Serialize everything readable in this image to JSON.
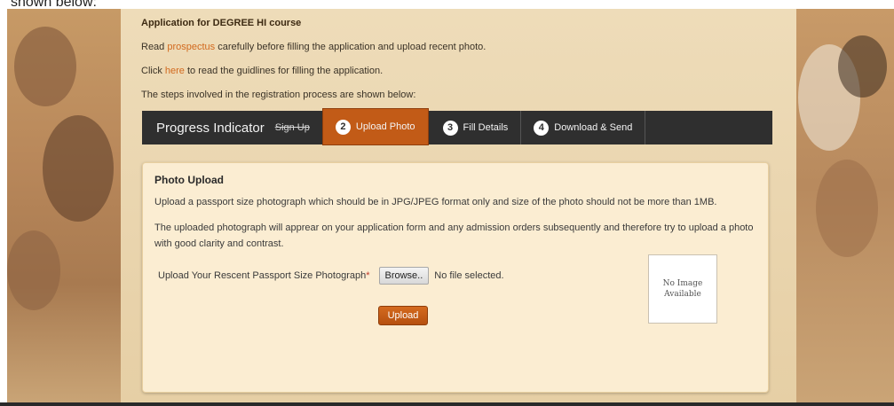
{
  "caption": "shown below:",
  "intro": {
    "title": "Application for DEGREE HI course",
    "line1_pre": "Read",
    "line1_link": "prospectus",
    "line1_post": "carefully before filling the application and upload recent photo.",
    "line2_pre": "Click",
    "line2_link": "here",
    "line2_post": "to read the guidlines for filling the application.",
    "line3": "The steps involved in the registration process are shown below:"
  },
  "progress": {
    "label": "Progress Indicator",
    "signup": "Sign Up",
    "steps": [
      {
        "num": "2",
        "label": "Upload Photo",
        "active": true
      },
      {
        "num": "3",
        "label": "Fill Details",
        "active": false
      },
      {
        "num": "4",
        "label": "Download & Send",
        "active": false
      }
    ]
  },
  "panel": {
    "heading": "Photo Upload",
    "text1": "Upload a passport size photograph which should be in JPG/JPEG format only and size of the photo should not be more than 1MB.",
    "text2": "The uploaded photograph will apprear on your application form and any admission orders subsequently and therefore try to upload a photo with good clarity and contrast.",
    "field_label": "Upload Your Rescent Passport Size Photograph",
    "required_mark": "*",
    "browse_label": "Browse..",
    "file_status": "No file selected.",
    "upload_label": "Upload",
    "no_image_line1": "No Image",
    "no_image_line2": "Available"
  },
  "colors": {
    "accent": "#c25b17",
    "link": "#d2691e",
    "progress_bar": "#2f2f2f",
    "panel_bg": "#fbedd2"
  }
}
